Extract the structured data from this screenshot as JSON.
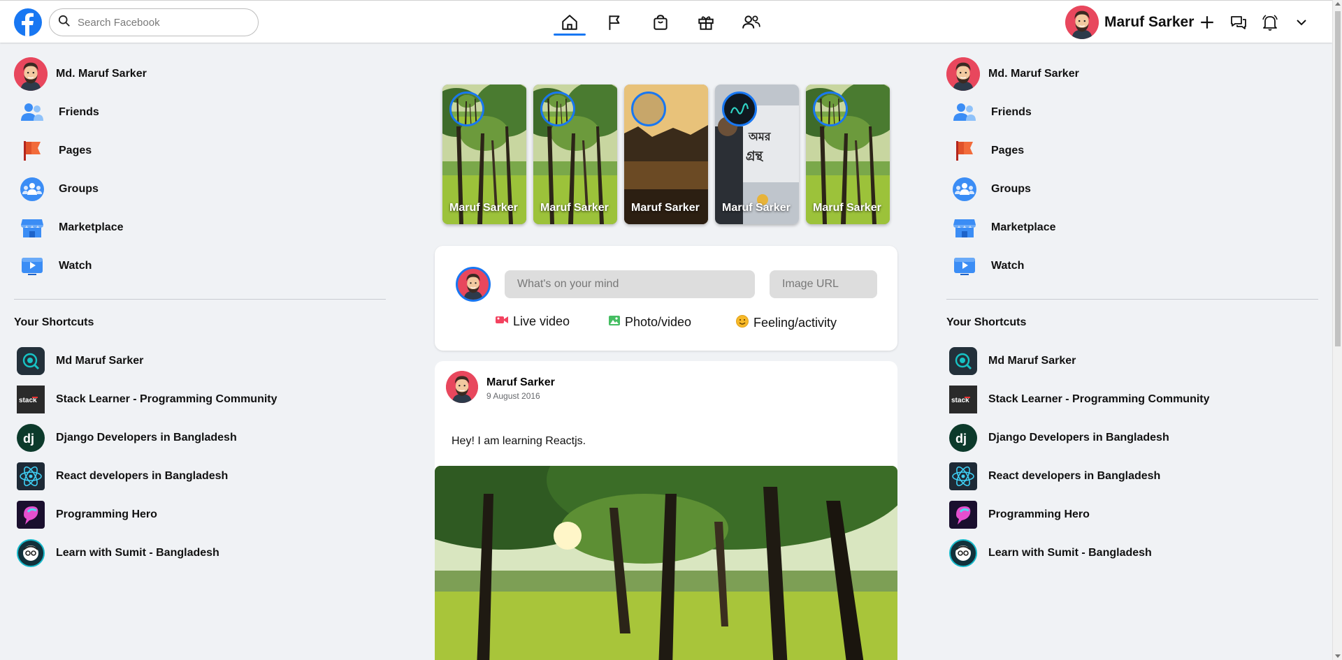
{
  "app": {
    "brand_color": "#1877f2",
    "background": "#f0f2f5"
  },
  "header": {
    "search_placeholder": "Search Facebook",
    "nav": [
      "home-icon",
      "flag-icon",
      "shopping-bag-icon",
      "gift-icon",
      "people-icon"
    ],
    "active_nav": "home",
    "user_name": "Maruf Sarker",
    "right_icons": [
      "plus-icon",
      "messenger-icon",
      "bell-icon",
      "chevron-down-icon"
    ]
  },
  "sidebar": {
    "profile_name": "Md. Maruf Sarker",
    "items": [
      {
        "label": "Friends",
        "icon": "friends-icon"
      },
      {
        "label": "Pages",
        "icon": "pages-flag-icon"
      },
      {
        "label": "Groups",
        "icon": "groups-icon"
      },
      {
        "label": "Marketplace",
        "icon": "marketplace-icon"
      },
      {
        "label": "Watch",
        "icon": "watch-icon"
      }
    ],
    "shortcuts_title": "Your Shortcuts",
    "shortcuts": [
      {
        "label": "Md Maruf Sarker"
      },
      {
        "label": "Stack Learner - Programming Community"
      },
      {
        "label": "Django Developers in Bangladesh"
      },
      {
        "label": "React developers in Bangladesh"
      },
      {
        "label": "Programming Hero"
      },
      {
        "label": "Learn with Sumit - Bangladesh"
      }
    ]
  },
  "stories": [
    {
      "name": "Maruf Sarker"
    },
    {
      "name": "Maruf Sarker"
    },
    {
      "name": "Maruf Sarker"
    },
    {
      "name": "Maruf Sarker"
    },
    {
      "name": "Maruf Sarker"
    }
  ],
  "composer": {
    "mind_placeholder": "What's on your mind",
    "image_placeholder": "Image URL",
    "actions": [
      "Live video",
      "Photo/video",
      "Feeling/activity"
    ]
  },
  "post": {
    "author": "Maruf Sarker",
    "date": "9 August 2016",
    "text": "Hey! I am learning Reactjs."
  }
}
